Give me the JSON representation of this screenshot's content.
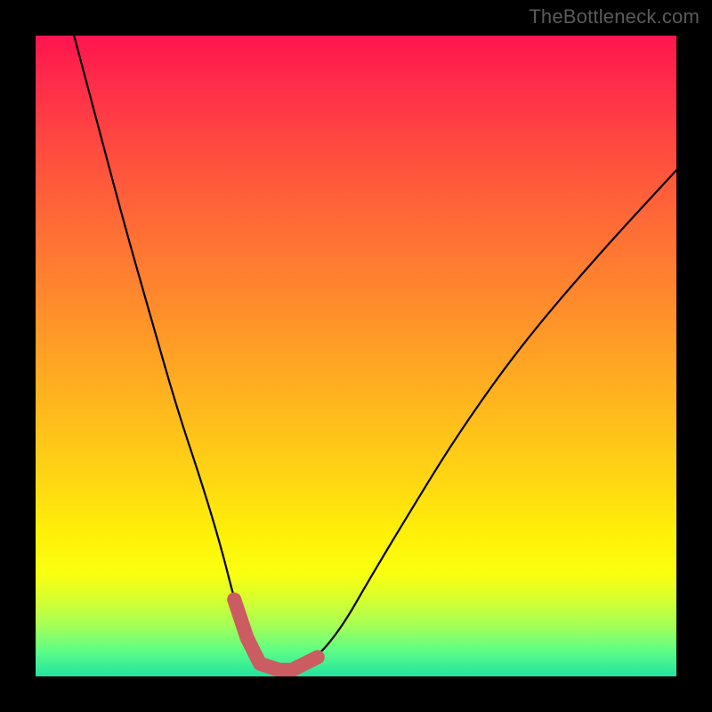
{
  "watermark": "TheBottleneck.com",
  "colors": {
    "frame": "#000000",
    "curve_thin": "#000000",
    "valley_accent": "#cb5c62",
    "gradient_stops": [
      "#ff154e",
      "#ff2e49",
      "#ff4c3f",
      "#ff6d35",
      "#ff8c2c",
      "#ffb020",
      "#ffd314",
      "#fff108",
      "#faff10",
      "#d6ff30",
      "#a6ff55",
      "#5dfd86",
      "#22e39f"
    ]
  },
  "chart_data": {
    "type": "line",
    "title": "",
    "xlabel": "",
    "ylabel": "",
    "xlim": [
      0,
      100
    ],
    "ylim": [
      0,
      100
    ],
    "grid": false,
    "legend": false,
    "series": [
      {
        "name": "bottleneck-curve",
        "x": [
          6,
          10,
          14,
          18,
          22,
          26,
          29,
          31,
          33,
          35,
          38,
          40,
          44,
          48,
          52,
          58,
          66,
          76,
          88,
          100
        ],
        "y": [
          100,
          85,
          70,
          56,
          42,
          30,
          20,
          12,
          6,
          2,
          1,
          1,
          3,
          8,
          15,
          25,
          38,
          52,
          66,
          79
        ]
      }
    ],
    "annotations": [
      {
        "name": "valley-highlight",
        "x_range": [
          31,
          44
        ],
        "y_approx": 2,
        "note": "thick salmon segment marking optimum (minimum) of curve"
      }
    ]
  }
}
